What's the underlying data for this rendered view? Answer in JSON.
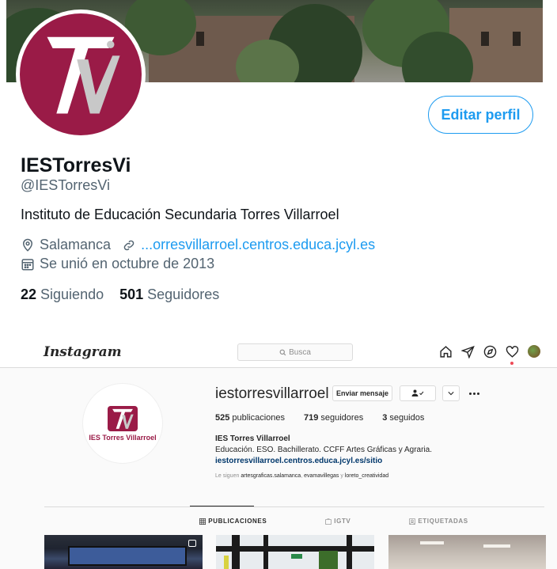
{
  "twitter": {
    "name": "IESTorresVi",
    "handle": "@IESTorresVi",
    "edit_profile_label": "Editar perfil",
    "bio": "Instituto de Educación Secundaria Torres Villarroel",
    "location": "Salamanca",
    "link": "...orresvillarroel.centros.educa.jcyl.es",
    "joined": "Se unió en octubre de 2013",
    "following_count": "22",
    "following_label": "Siguiendo",
    "followers_count": "501",
    "followers_label": "Seguidores",
    "colors": {
      "accent": "#1d9bf0",
      "avatar_bg": "#9a1b47"
    }
  },
  "instagram": {
    "logo": "Instagram",
    "search_placeholder": "Busca",
    "username": "iestorresvillarroel",
    "message_button": "Enviar mensaje",
    "avatar_caption": "IES Torres Villarroel",
    "stats": [
      {
        "count": "525",
        "label": "publicaciones"
      },
      {
        "count": "719",
        "label": "seguidores"
      },
      {
        "count": "3",
        "label": "seguidos"
      }
    ],
    "full_name": "IES Torres Villarroel",
    "bio": "Educación. ESO. Bachillerato. CCFF Artes Gráficas y Agraria.",
    "url": "iestorresvillarroel.centros.educa.jcyl.es/sitio",
    "followed_by_prefix": "Le siguen",
    "followed_by_1": "artesgraficas.salamanca",
    "followed_by_2": "evamavillegas",
    "followed_by_and": "y",
    "followed_by_3": "loreto_creatividad",
    "tabs": [
      "PUBLICACIONES",
      "IGTV",
      "ETIQUETADAS"
    ],
    "nav_icons": [
      "home-icon",
      "direct-icon",
      "explore-icon",
      "heart-icon",
      "profile-avatar"
    ]
  }
}
